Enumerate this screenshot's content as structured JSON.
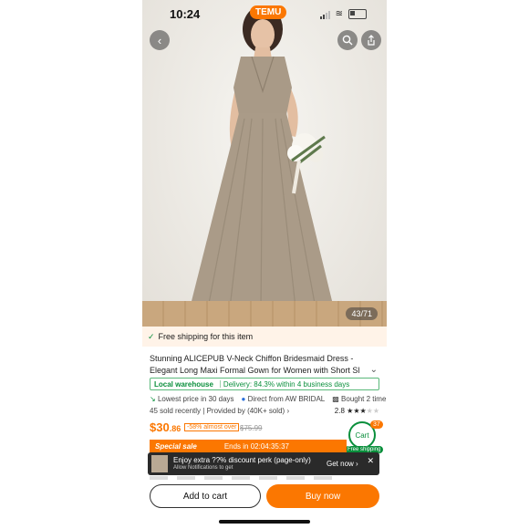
{
  "status": {
    "time": "10:24",
    "app_badge": "TEMU"
  },
  "hero": {
    "counter": "43/71"
  },
  "shipping_banner": "Free shipping for this item",
  "product": {
    "title": "Stunning ALICEPUB V-Neck Chiffon Bridesmaid Dress - Elegant Long Maxi Formal Gown for Women with Short Sl",
    "warehouse_label": "Local warehouse",
    "delivery_text": "Delivery: 84.3% within 4 business days",
    "lowest_price": "Lowest price in 30 days",
    "direct_from": "Direct from AW BRIDAL",
    "bought": "Bought 2 time",
    "sold_recently": "45 sold recently",
    "provided_by": "Provided by",
    "provider_sold": "(40K+ sold)",
    "rating": "2.8",
    "price_int": "$30",
    "price_dec": ".86",
    "discount": "-58% almost over",
    "original_price": "$75.99"
  },
  "cart": {
    "label": "Cart",
    "count": "37",
    "free_shipping": "Free shipping"
  },
  "sale": {
    "label": "Special sale",
    "ends": "Ends in 02:04:35:37"
  },
  "notification": {
    "title": "Enjoy extra ??% discount perk (page-only)",
    "subtitle": "Allow Notifications to get",
    "action": "Get now"
  },
  "actions": {
    "add_to_cart": "Add to cart",
    "buy_now": "Buy now"
  },
  "colors": {
    "accent": "#fb7701",
    "green": "#0a8f3c"
  }
}
